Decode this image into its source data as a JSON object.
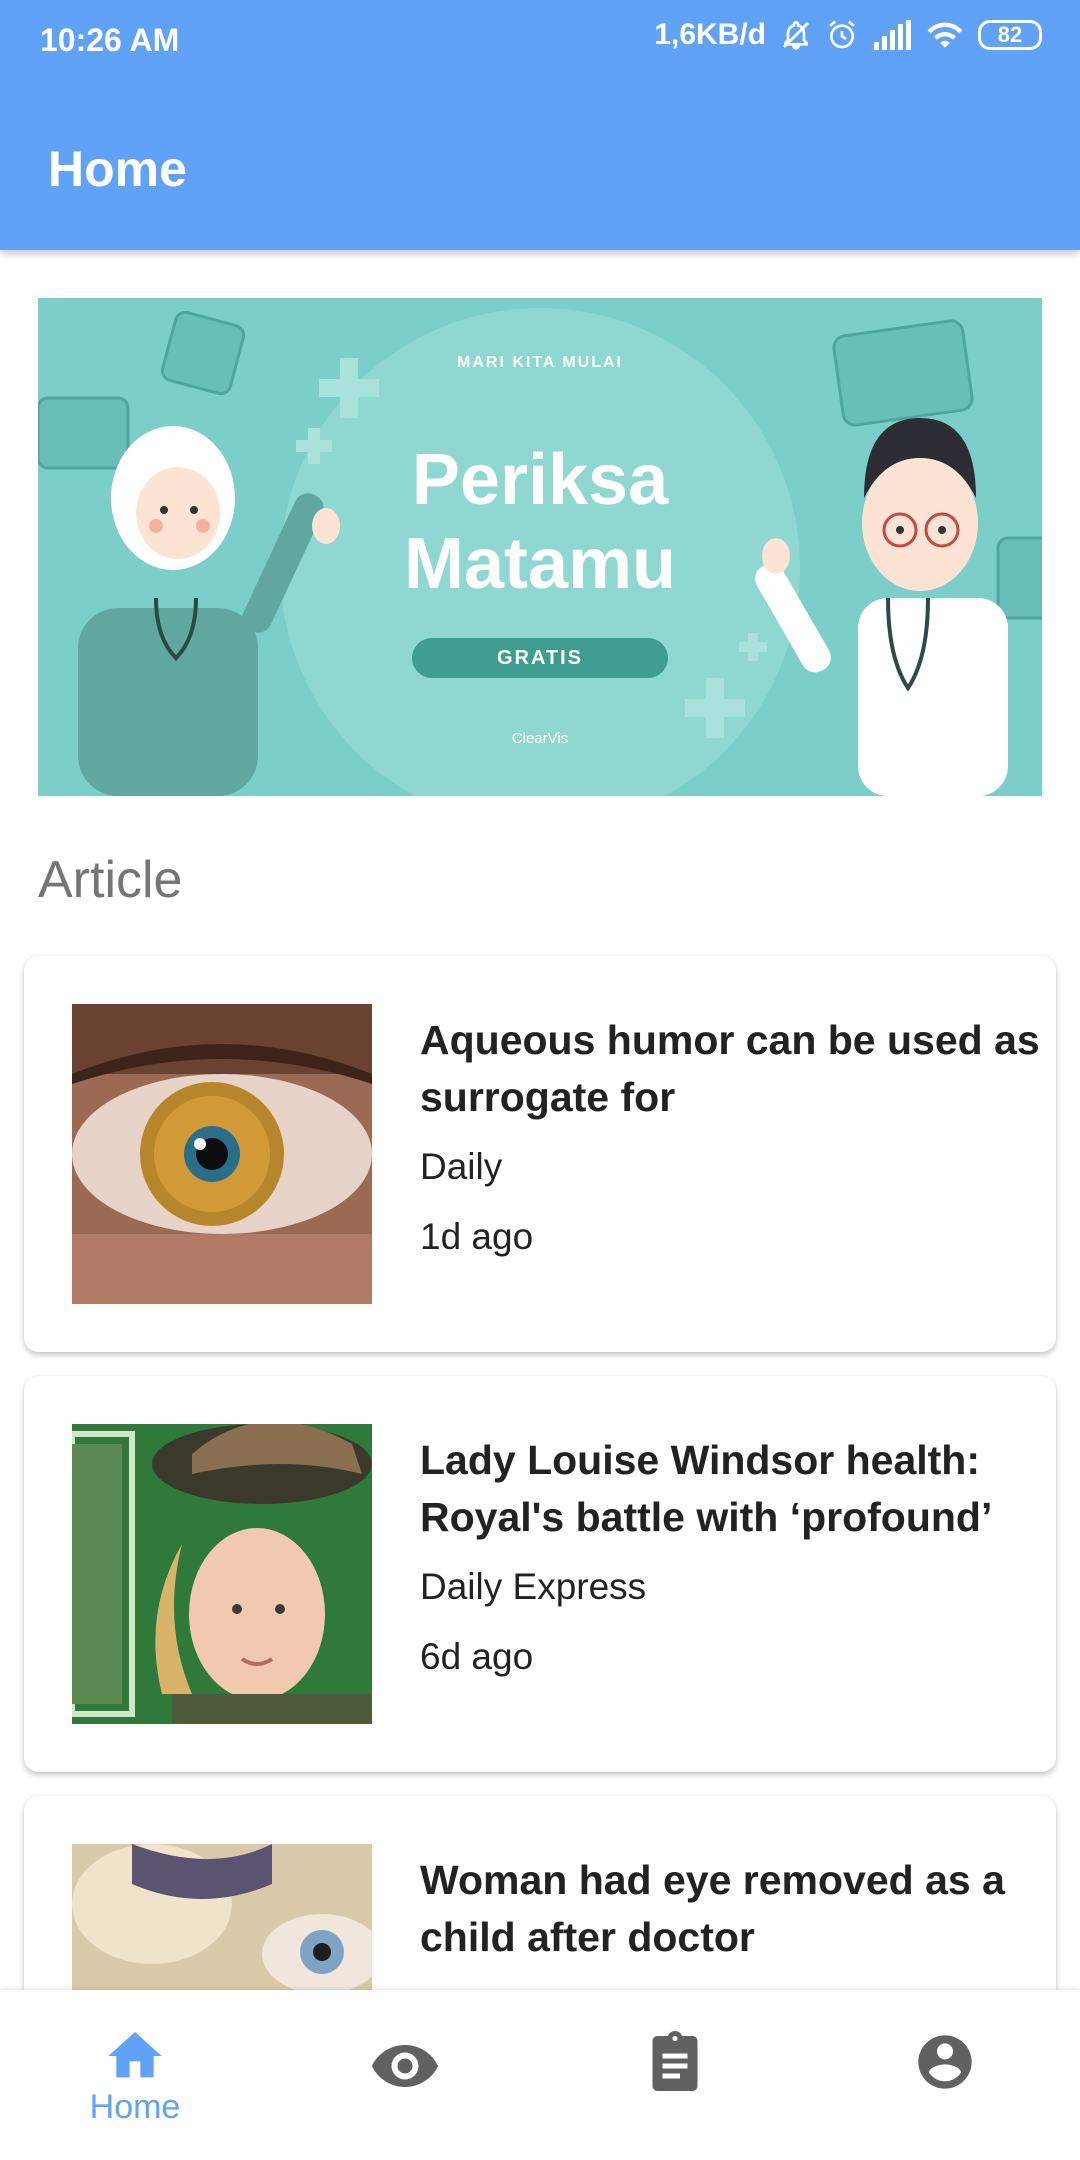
{
  "status_bar": {
    "time": "10:26 AM",
    "network_speed": "1,6KB/d",
    "battery": "82",
    "icons": [
      "bell-off-icon",
      "alarm-icon",
      "signal-icon",
      "wifi-icon",
      "battery-icon"
    ]
  },
  "app_bar": {
    "title": "Home"
  },
  "banner": {
    "kicker": "MARI KITA MULAI",
    "title_line1": "Periksa",
    "title_line2": "Matamu",
    "badge": "GRATIS",
    "brand": "ClearVis"
  },
  "section": {
    "title": "Article"
  },
  "articles": [
    {
      "title": "Aqueous humor can be used as surrogate for",
      "source": "Daily",
      "time": "1d ago",
      "thumbnail": "eye-closeup"
    },
    {
      "title": "Lady Louise Windsor health: Royal's battle with ‘profound’",
      "source": "Daily Express",
      "time": "6d ago",
      "thumbnail": "woman-in-hat"
    },
    {
      "title": "Woman had eye removed as a child after doctor",
      "source": "",
      "time": "",
      "thumbnail": "eye-patch"
    }
  ],
  "bottom_nav": {
    "items": [
      {
        "icon": "home-icon",
        "label": "Home",
        "active": true
      },
      {
        "icon": "eye-icon",
        "label": "",
        "active": false
      },
      {
        "icon": "clipboard-icon",
        "label": "",
        "active": false
      },
      {
        "icon": "account-icon",
        "label": "",
        "active": false
      }
    ]
  },
  "colors": {
    "primary": "#60a2f7",
    "banner_bg": "#7ccfc9",
    "inactive_icon": "#616161",
    "section_title": "#757575"
  }
}
